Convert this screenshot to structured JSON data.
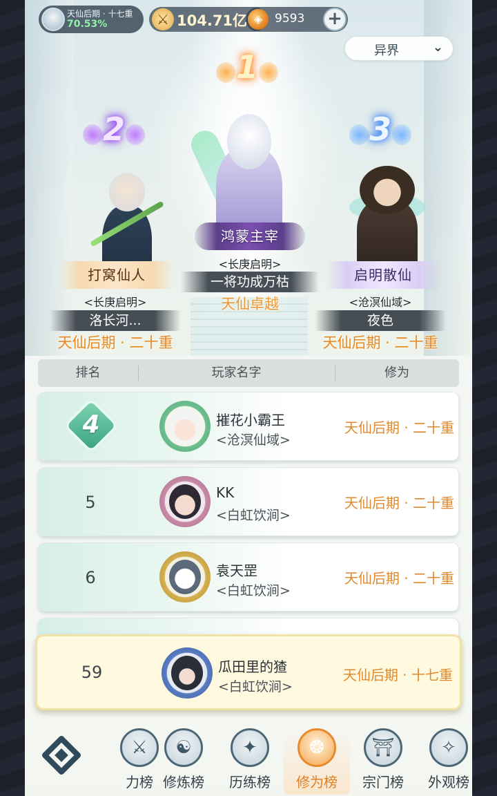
{
  "top_bar": {
    "realm_name": "天仙后期 · 十七重",
    "realm_progress": "70.53%",
    "power_value": "104.71亿",
    "currency_value": "9593",
    "add_button_label": "+"
  },
  "realm_dropdown": {
    "selected": "异界"
  },
  "podium": [
    {
      "rank": "1",
      "title": "鸿蒙主宰",
      "sect": "<长庚启明>",
      "player": "一将功成万枯",
      "realm": "天仙卓越"
    },
    {
      "rank": "2",
      "title": "打窝仙人",
      "sect": "<长庚启明>",
      "player": "洛长河...",
      "realm": "天仙后期 · 二十重"
    },
    {
      "rank": "3",
      "title": "启明散仙",
      "sect": "<沧溟仙域>",
      "player": "夜色",
      "realm": "天仙后期 · 二十重"
    }
  ],
  "table": {
    "headers": {
      "rank": "排名",
      "name": "玩家名字",
      "cultivation": "修为"
    },
    "rows": [
      {
        "rank": "4",
        "name": "摧花小霸王",
        "sect": "<沧溟仙域>",
        "cultivation": "天仙后期 · 二十重"
      },
      {
        "rank": "5",
        "name": "KK",
        "sect": "<白虹饮涧>",
        "cultivation": "天仙后期 · 二十重"
      },
      {
        "rank": "6",
        "name": "袁天罡",
        "sect": "<白虹饮涧>",
        "cultivation": "天仙后期 · 二十重"
      }
    ]
  },
  "my_rank": {
    "rank": "59",
    "name": "瓜田里的猹",
    "sect": "<白虹饮涧>",
    "cultivation": "天仙后期 · 十七重"
  },
  "bottom_nav": {
    "items": [
      {
        "label": "战力榜",
        "visible_label": "力榜",
        "icon": "sword-icon"
      },
      {
        "label": "修炼榜",
        "icon": "yinyang-icon"
      },
      {
        "label": "历练榜",
        "icon": "compass-star-icon"
      },
      {
        "label": "修为榜",
        "icon": "cultivation-icon",
        "active": true
      },
      {
        "label": "宗门榜",
        "icon": "gate-icon"
      },
      {
        "label": "外观榜",
        "icon": "appearance-icon"
      }
    ]
  },
  "colors": {
    "accent_orange": "#e08a2e",
    "active_tab": "#e37f22",
    "my_row_bg": "#fff9df"
  }
}
